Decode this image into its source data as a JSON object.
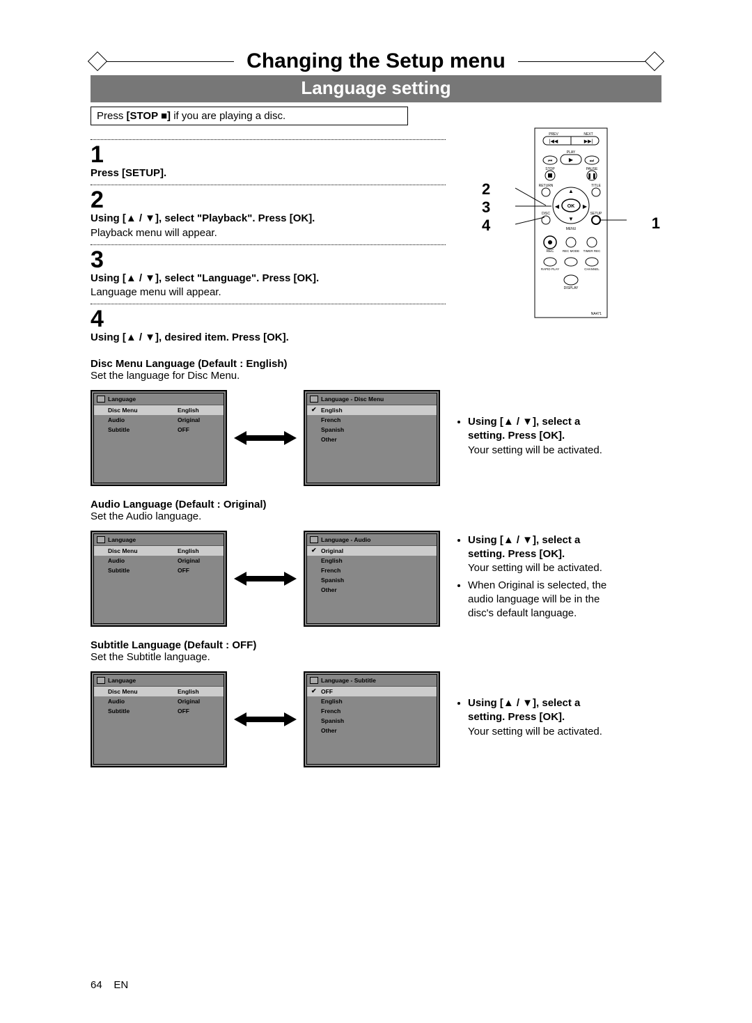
{
  "page_title": "Changing the Setup menu",
  "subtitle": "Language setting",
  "pre_note_pre": "Press ",
  "pre_note_key": "[STOP ■]",
  "pre_note_post": " if you are playing a disc.",
  "steps": {
    "s1": {
      "no": "1",
      "bold": "Press [SETUP]."
    },
    "s2": {
      "no": "2",
      "bold": "Using [▲ / ▼], select \"Playback\". Press [OK].",
      "line": "Playback menu will appear."
    },
    "s3": {
      "no": "3",
      "bold": "Using [▲ / ▼], select \"Language\". Press [OK].",
      "line": "Language menu will appear."
    },
    "s4": {
      "no": "4",
      "bold": "Using [▲ / ▼], desired item. Press [OK]."
    }
  },
  "remote_refs": {
    "left": [
      "2",
      "3",
      "4"
    ],
    "right": "1"
  },
  "remote_labels": {
    "prev": "PREV",
    "next": "NEXT",
    "play": "PLAY",
    "stop": "STOP",
    "pause": "PAUSE",
    "return": "RETURN",
    "title": "TITLE",
    "disc": "DISC",
    "setup": "SETUP",
    "menu": "MENU",
    "ok": "OK",
    "rec": "REC",
    "recmode": "REC MODE",
    "timerrec": "TIMER REC",
    "rapidplay": "RAPID PLAY",
    "channel": "CHANNEL",
    "display": "DISPLAY",
    "model": "NA471"
  },
  "lang_menu": {
    "title": "Language",
    "rows": [
      {
        "label": "Disc Menu",
        "value": "English"
      },
      {
        "label": "Audio",
        "value": "Original"
      },
      {
        "label": "Subtitle",
        "value": "OFF"
      }
    ]
  },
  "disc_section": {
    "title": "Disc Menu Language (Default : English)",
    "desc": "Set the language for Disc Menu.",
    "panel": {
      "title": "Language - Disc Menu",
      "items": [
        "English",
        "French",
        "Spanish",
        "Other"
      ],
      "selected": 0
    },
    "side_bold": "Using [▲ / ▼], select a setting. Press [OK].",
    "side_line": "Your setting will be activated."
  },
  "audio_section": {
    "title": "Audio Language (Default : Original)",
    "desc": "Set the Audio language.",
    "panel": {
      "title": "Language - Audio",
      "items": [
        "Original",
        "English",
        "French",
        "Spanish",
        "Other"
      ],
      "selected": 0
    },
    "side_bold": "Using [▲ / ▼], select a setting. Press [OK].",
    "side_line1": "Your setting will be activated.",
    "side_line2": "When Original is selected, the audio language will be in the disc's default language."
  },
  "subtitle_section": {
    "title": "Subtitle Language (Default : OFF)",
    "desc": "Set the Subtitle language.",
    "panel": {
      "title": "Language - Subtitle",
      "items": [
        "OFF",
        "English",
        "French",
        "Spanish",
        "Other"
      ],
      "selected": 0
    },
    "side_bold": "Using [▲ / ▼], select a setting. Press [OK].",
    "side_line": "Your setting will be activated."
  },
  "footer": {
    "pageno": "64",
    "lang": "EN"
  }
}
